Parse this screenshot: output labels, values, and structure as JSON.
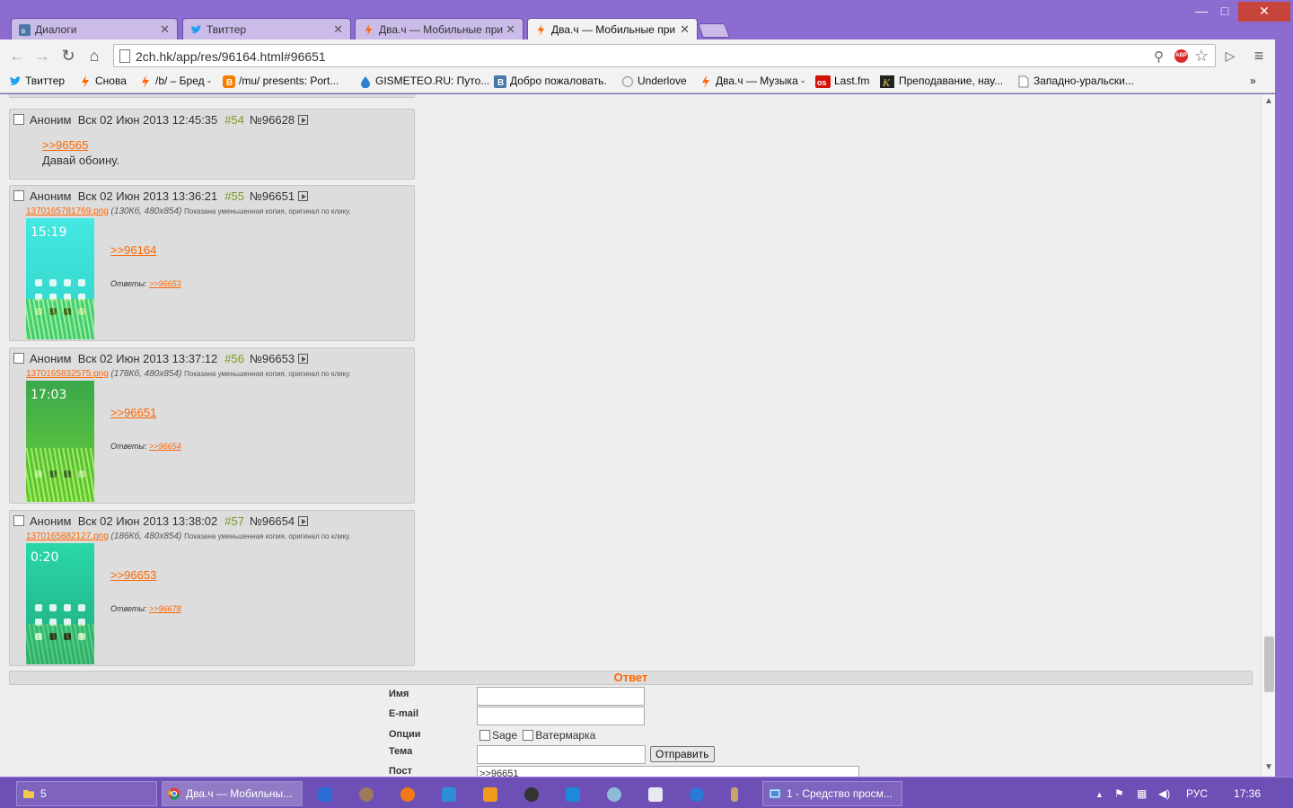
{
  "tabs": [
    {
      "title": "Диалоги",
      "icon": "vk-icon",
      "color": "#4a76a8"
    },
    {
      "title": "Твиттер",
      "icon": "twitter-bird-icon",
      "color": "#1da1f2"
    },
    {
      "title": "Два.ч — Мобильные при",
      "icon": "lightning-icon",
      "color": "#ff6600"
    },
    {
      "title": "Два.ч — Мобильные при",
      "icon": "lightning-icon",
      "color": "#ff6600"
    }
  ],
  "window": {
    "minimize": "—",
    "maximize": "□",
    "close": "✕"
  },
  "toolbar": {
    "back": "←",
    "forward": "→",
    "reload": "↻",
    "home": "⌂",
    "url": "2ch.hk/app/res/96164.html#96651",
    "abp_label": "ABP",
    "menu": "≡"
  },
  "bookmarks": [
    {
      "label": "Твиттер",
      "icon": "twitter-bird-icon",
      "color": "#1da1f2"
    },
    {
      "label": "Снова",
      "icon": "lightning-icon",
      "color": "#ff6600"
    },
    {
      "label": "/b/ – Бред -",
      "icon": "lightning-icon",
      "color": "#ff6600"
    },
    {
      "label": "/mu/ presents: Port...",
      "icon": "blogger-icon",
      "color": "#f57d00"
    },
    {
      "label": "GISMETEO.RU: Путо...",
      "icon": "drop-icon",
      "color": "#2f7fd6"
    },
    {
      "label": "Добро пожаловать.",
      "icon": "vk-icon",
      "color": "#4a76a8"
    },
    {
      "label": "Underlove",
      "icon": "circle-icon",
      "color": "#cccccc"
    },
    {
      "label": "Два.ч — Музыка -",
      "icon": "lightning-icon",
      "color": "#ff6600"
    },
    {
      "label": "Last.fm",
      "icon": "lastfm-icon",
      "color": "#d51007"
    },
    {
      "label": "Преподавание, нау...",
      "icon": "k-icon",
      "color": "#222222"
    },
    {
      "label": "Западно-уральски...",
      "icon": "page-icon",
      "color": "#ffffff"
    }
  ],
  "bookmarks_overflow": "»",
  "posts": [
    {
      "author": "Аноним",
      "date": "Вск 02 Июн 2013 12:45:35",
      "num": "#54",
      "id": "№96628",
      "reply": ">>96565",
      "text": "Давай обоину."
    },
    {
      "author": "Аноним",
      "date": "Вск 02 Июн 2013 13:36:21",
      "num": "#55",
      "id": "№96651",
      "file": "1370165781769.png",
      "size": "(130Кб, 480x854)",
      "note": "Показана уменьшенная копия, оригинал по клику.",
      "clock": "15:19",
      "thumb_color": "#3fe0d8",
      "reply": ">>96164",
      "answers_label": "Ответы:",
      "answers": ">>96653"
    },
    {
      "author": "Аноним",
      "date": "Вск 02 Июн 2013 13:37:12",
      "num": "#56",
      "id": "№96653",
      "file": "1370165832575.png",
      "size": "(178Кб, 480x854)",
      "note": "Показана уменьшенная копия, оригинал по клику.",
      "clock": "17:03",
      "thumb_color": "#2f9e4a",
      "reply": ">>96651",
      "answers_label": "Ответы:",
      "answers": ">>96654"
    },
    {
      "author": "Аноним",
      "date": "Вск 02 Июн 2013 13:38:02",
      "num": "#57",
      "id": "№96654",
      "file": "1370165882127.png",
      "size": "(186Кб, 480x854)",
      "note": "Показана уменьшенная копия, оригинал по клику.",
      "clock": "0:20",
      "thumb_color": "#1fc49a",
      "reply": ">>96653",
      "answers_label": "Ответы:",
      "answers": ">>96678"
    }
  ],
  "reply_form": {
    "title": "Ответ",
    "name_label": "Имя",
    "email_label": "E-mail",
    "options_label": "Опции",
    "sage_label": "Sage",
    "watermark_label": "Ватермарка",
    "subject_label": "Тема",
    "submit_label": "Отправить",
    "post_label": "Пост",
    "post_value": ">>96651"
  },
  "taskbar": {
    "folder_label": "5",
    "chrome_label": "Два.ч — Мобильны...",
    "viewer_label": "1 - Средство просм...",
    "lang": "РУС",
    "time": "17:36"
  }
}
